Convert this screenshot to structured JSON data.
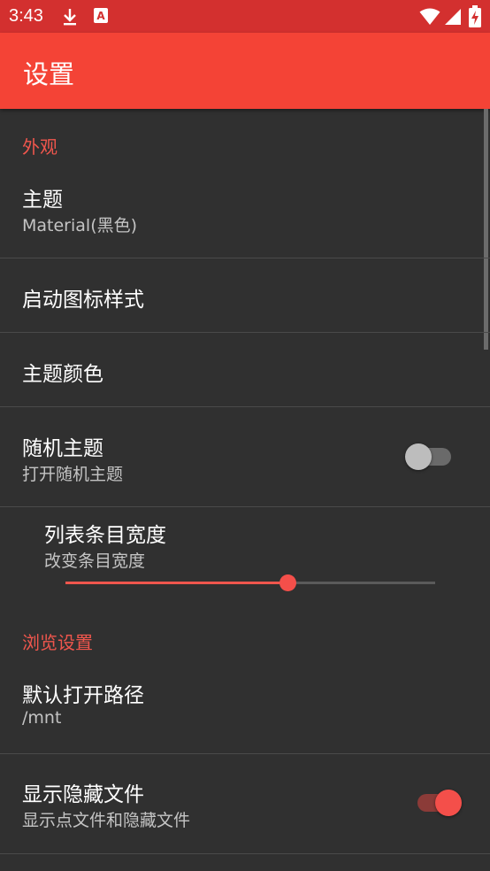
{
  "status_bar": {
    "time": "3:43",
    "color": "#d3302f",
    "icons": [
      "download-icon",
      "notification-a-icon",
      "wifi-icon",
      "signal-icon",
      "battery-charging-icon"
    ],
    "notification_letter": "A"
  },
  "app_bar": {
    "title": "设置",
    "color": "#f44336"
  },
  "sections": {
    "appearance": {
      "header": "外观",
      "theme": {
        "title": "主题",
        "summary": "Material(黑色)"
      },
      "launcher_icon": {
        "title": "启动图标样式"
      },
      "theme_color": {
        "title": "主题颜色"
      },
      "random_theme": {
        "title": "随机主题",
        "summary": "打开随机主题",
        "enabled": false
      },
      "item_width": {
        "title": "列表条目宽度",
        "summary": "改变条目宽度",
        "value": 0.6
      }
    },
    "browse": {
      "header": "浏览设置",
      "default_path": {
        "title": "默认打开路径",
        "summary": "/mnt"
      },
      "show_hidden": {
        "title": "显示隐藏文件",
        "summary": "显示点文件和隐藏文件",
        "enabled": true
      }
    }
  },
  "accent_color": "#f0564d"
}
